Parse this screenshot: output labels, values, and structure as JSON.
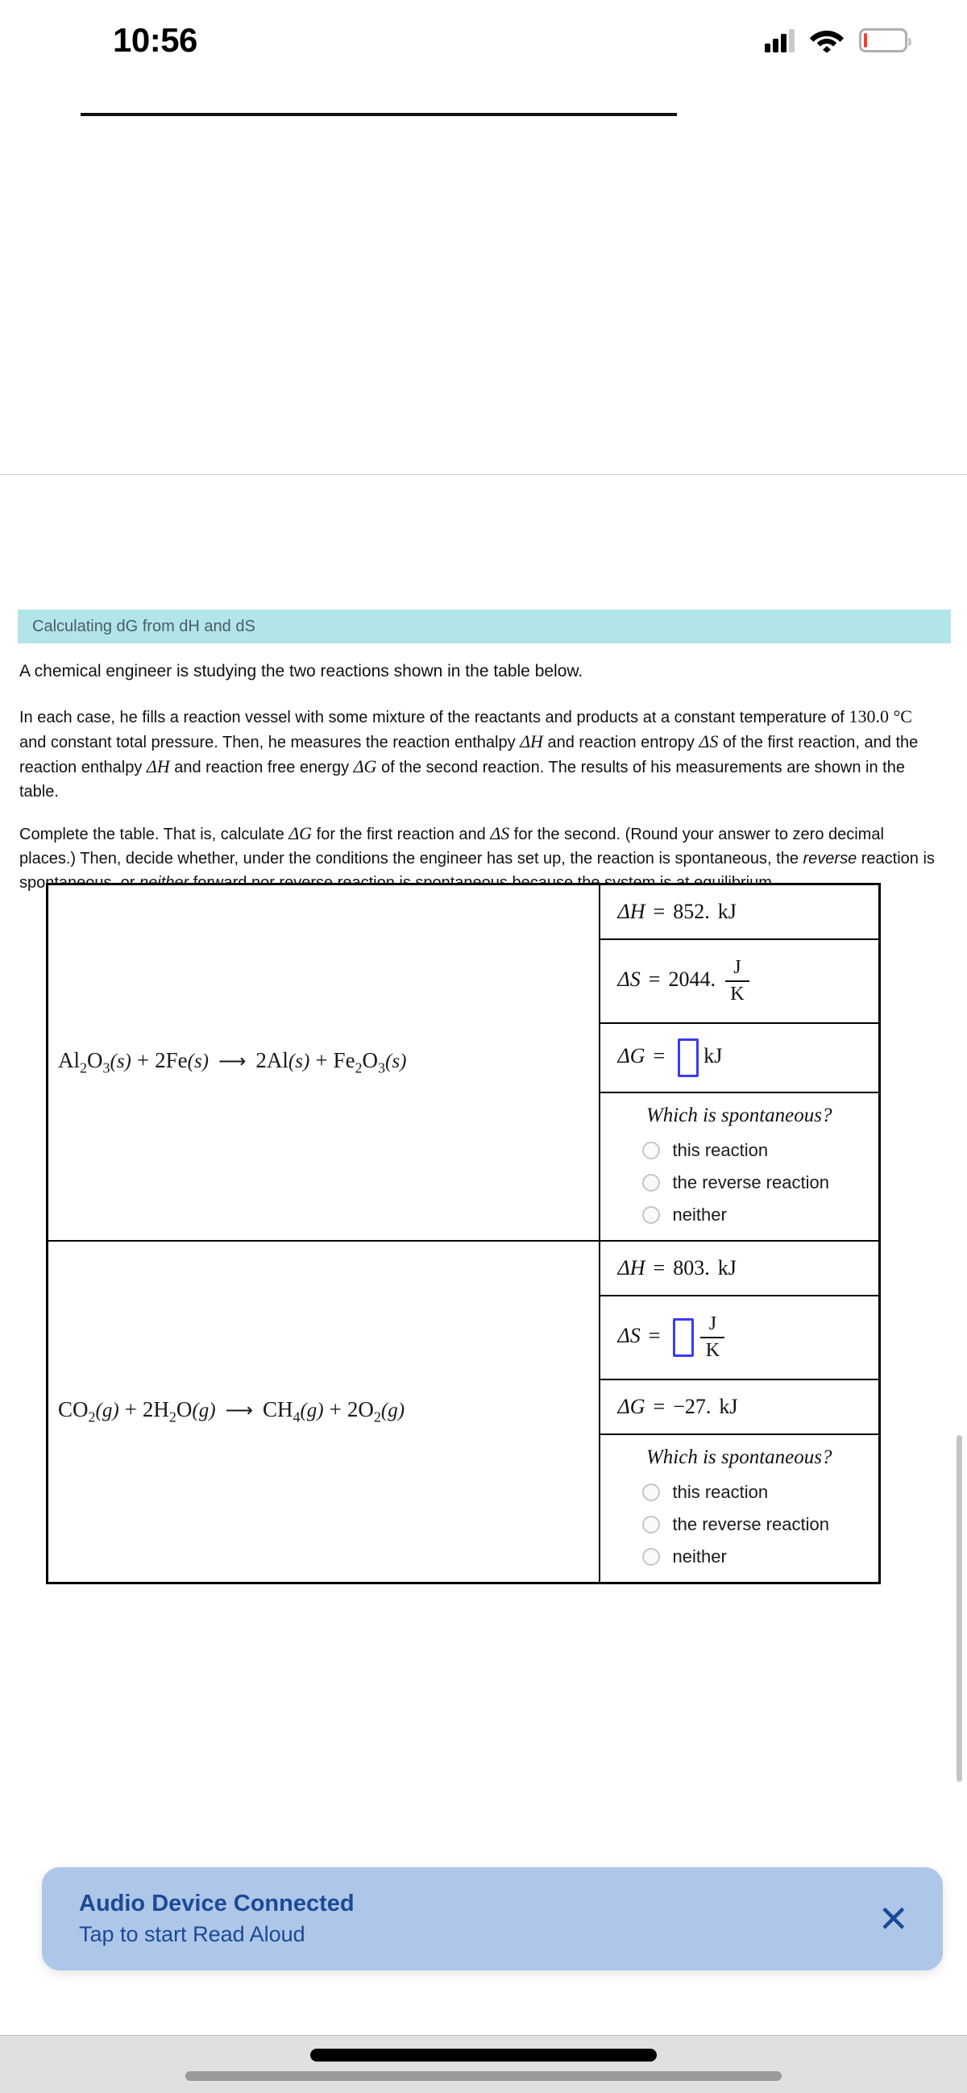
{
  "status_bar": {
    "time": "10:56",
    "signal_icon": "cellular-signal-icon",
    "wifi_icon": "wifi-icon",
    "battery_icon": "battery-low-icon",
    "battery_color": "#ff3b30"
  },
  "section": {
    "header_title": "Calculating dG from dH and dS",
    "header_bg": "#b2e5e8"
  },
  "problem": {
    "para1": "A chemical engineer is studying the two reactions shown in the table below.",
    "para2_a": "In each case, he fills a reaction vessel with some mixture of the reactants and products at a constant temperature of ",
    "para2_temp": "130.0 °C",
    "para2_b": " and constant total pressure. Then, he measures the reaction enthalpy ",
    "para2_dH": "ΔH",
    "para2_c": " and reaction entropy ",
    "para2_dS": "ΔS",
    "para2_d": " of the first reaction, and the reaction enthalpy ",
    "para2_dH2": "ΔH",
    "para2_e": " and reaction free energy ",
    "para2_dG": "ΔG",
    "para2_f": " of the second reaction. The results of his measurements are shown in the table.",
    "para3_a": "Complete the table. That is, calculate ",
    "para3_dG": "ΔG",
    "para3_b": " for the first reaction and ",
    "para3_dS": "ΔS",
    "para3_c": " for the second. (Round your answer to zero decimal places.) Then, decide whether, under the conditions the engineer has set up, the reaction is spontaneous, the ",
    "para3_reverse": "reverse",
    "para3_d": " reaction is spontaneous, or ",
    "para3_neither": "neither",
    "para3_e": " forward nor reverse reaction is spontaneous because the system is at equilibrium."
  },
  "table": {
    "rows": [
      {
        "equation": {
          "reactant1": {
            "formula": "Al",
            "sub1": "2",
            "elem2": "O",
            "sub2": "3",
            "state": "(s)"
          },
          "reactant2": {
            "coeff": "2",
            "formula": "Fe",
            "state": "(s)"
          },
          "arrow": "→",
          "product1": {
            "coeff": "2",
            "formula": "Al",
            "state": "(s)"
          },
          "product2": {
            "formula": "Fe",
            "sub1": "2",
            "elem2": "O",
            "sub2": "3",
            "state": "(s)"
          },
          "plain": "Al2O3 (s) + 2Fe(s) → 2Al(s) + Fe2O3 (s)"
        },
        "dH": {
          "symbol": "ΔH",
          "eq": "=",
          "value": "852.",
          "unit": "kJ",
          "is_input": false
        },
        "dS": {
          "symbol": "ΔS",
          "eq": "=",
          "value": "2044.",
          "unit_num": "J",
          "unit_den": "K",
          "is_input": false
        },
        "dG": {
          "symbol": "ΔG",
          "eq": "=",
          "value": "",
          "unit": "kJ",
          "is_input": true
        },
        "spontaneity": {
          "prompt": "Which is spontaneous?",
          "options": [
            "this reaction",
            "the reverse reaction",
            "neither"
          ],
          "selected": null
        }
      },
      {
        "equation": {
          "reactant1": {
            "formula": "CO",
            "sub1": "2",
            "state": "(g)"
          },
          "reactant2": {
            "coeff": "2",
            "formula": "H",
            "sub1": "2",
            "elem2": "O",
            "state": "(g)"
          },
          "arrow": "→",
          "product1": {
            "formula": "CH",
            "sub1": "4",
            "state": "(g)"
          },
          "product2": {
            "coeff": "2",
            "formula": "O",
            "sub1": "2",
            "state": "(g)"
          },
          "plain": "CO2 (g) + 2H2O(g) → CH4 (g) + 2O2 (g)"
        },
        "dH": {
          "symbol": "ΔH",
          "eq": "=",
          "value": "803.",
          "unit": "kJ",
          "is_input": false
        },
        "dS": {
          "symbol": "ΔS",
          "eq": "=",
          "value": "",
          "unit_num": "J",
          "unit_den": "K",
          "is_input": true
        },
        "dG": {
          "symbol": "ΔG",
          "eq": "=",
          "value": "−27.",
          "unit": "kJ",
          "is_input": false
        },
        "spontaneity": {
          "prompt": "Which is spontaneous?",
          "options": [
            "this reaction",
            "the reverse reaction",
            "neither"
          ],
          "selected": null
        }
      }
    ]
  },
  "banner": {
    "title": "Audio Device Connected",
    "subtitle": "Tap to start Read Aloud",
    "close_icon": "✕",
    "bg": "#aec6e8",
    "text_color": "#1b4a96"
  }
}
